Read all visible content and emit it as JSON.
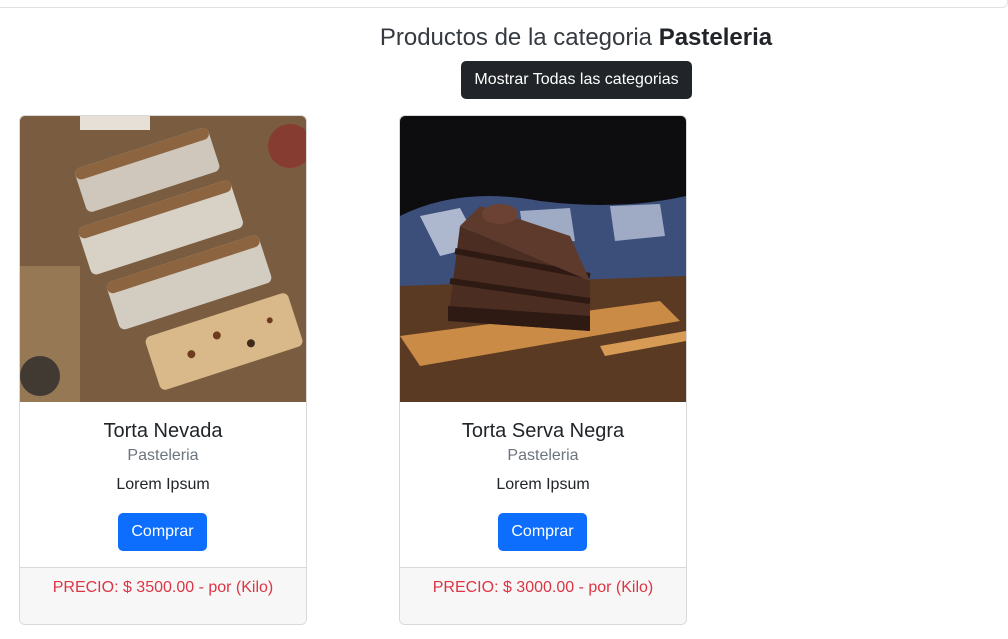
{
  "header": {
    "title_prefix": "Productos de la categoria",
    "category": "Pasteleria",
    "show_all_label": "Mostrar Todas las categorias"
  },
  "products": [
    {
      "name": "Torta Nevada",
      "category": "Pasteleria",
      "description": "Lorem Ipsum",
      "buy_label": "Comprar",
      "price_text": "PRECIO: $ 3500.00 - por (Kilo)",
      "image": "sliced-fruit-bread-photo"
    },
    {
      "name": "Torta Serva Negra",
      "category": "Pasteleria",
      "description": "Lorem Ipsum",
      "buy_label": "Comprar",
      "price_text": "PRECIO: $ 3000.00 - por (Kilo)",
      "image": "chocolate-layer-cake-photo"
    }
  ],
  "colors": {
    "primary": "#0d6efd",
    "dark": "#212529",
    "danger": "#dc3545",
    "muted": "#6c757d"
  }
}
